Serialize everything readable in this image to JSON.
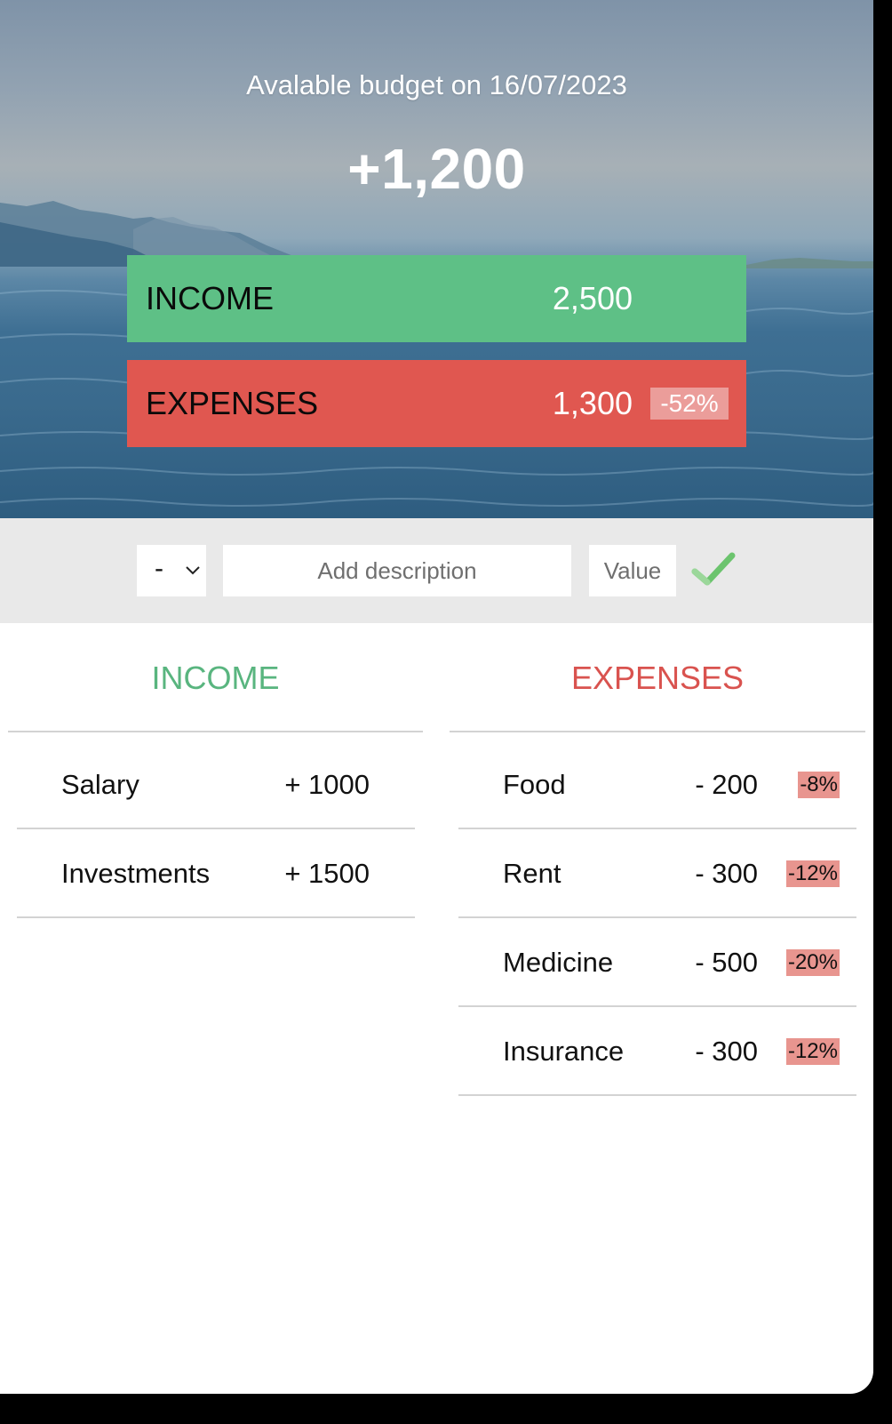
{
  "header": {
    "title": "Avalable budget on 16/07/2023",
    "available": "+1,200"
  },
  "summary": {
    "income": {
      "label": "INCOME",
      "value": "2,500"
    },
    "expenses": {
      "label": "EXPENSES",
      "value": "1,300",
      "percentage": "-52%"
    }
  },
  "add_form": {
    "type_selected": "-",
    "description_placeholder": "Add description",
    "value_placeholder": "Value",
    "submit_icon": "checkmark-icon"
  },
  "income_list": {
    "title": "INCOME",
    "items": [
      {
        "description": "Salary",
        "value": "+ 1000"
      },
      {
        "description": "Investments",
        "value": "+ 1500"
      }
    ]
  },
  "expenses_list": {
    "title": "EXPENSES",
    "items": [
      {
        "description": "Food",
        "value": "- 200",
        "percentage": "-8%"
      },
      {
        "description": "Rent",
        "value": "- 300",
        "percentage": "-12%"
      },
      {
        "description": "Medicine",
        "value": "- 500",
        "percentage": "-20%"
      },
      {
        "description": "Insurance",
        "value": "- 300",
        "percentage": "-12%"
      }
    ]
  },
  "colors": {
    "income": "#5ec086",
    "expenses": "#e05750",
    "income_text": "#59b57f",
    "expenses_text": "#d9534f",
    "badge": "#e8958f"
  }
}
